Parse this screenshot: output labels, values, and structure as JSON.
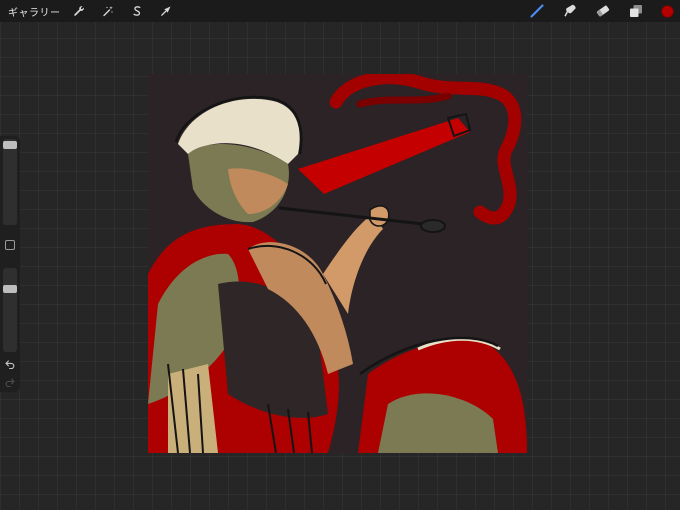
{
  "toolbar": {
    "gallery_label": "ギャラリー",
    "left_icons": [
      "wrench-icon",
      "magic-wand-icon",
      "selection-icon",
      "transform-arrow-icon"
    ],
    "right_icons": [
      "brush-icon",
      "smudge-icon",
      "eraser-icon",
      "layers-icon"
    ],
    "current_color": "#b50000"
  },
  "sidebar": {
    "brush_size_level": 0.03,
    "opacity_level": 0.22,
    "icons": [
      "modify-square-icon",
      "undo-icon",
      "redo-icon"
    ]
  },
  "canvas": {
    "background_color": "#2b2326",
    "palette": [
      "#ad0000",
      "#e00000",
      "#7c7a52",
      "#c9b07a",
      "#e8e0c8",
      "#141414"
    ]
  }
}
